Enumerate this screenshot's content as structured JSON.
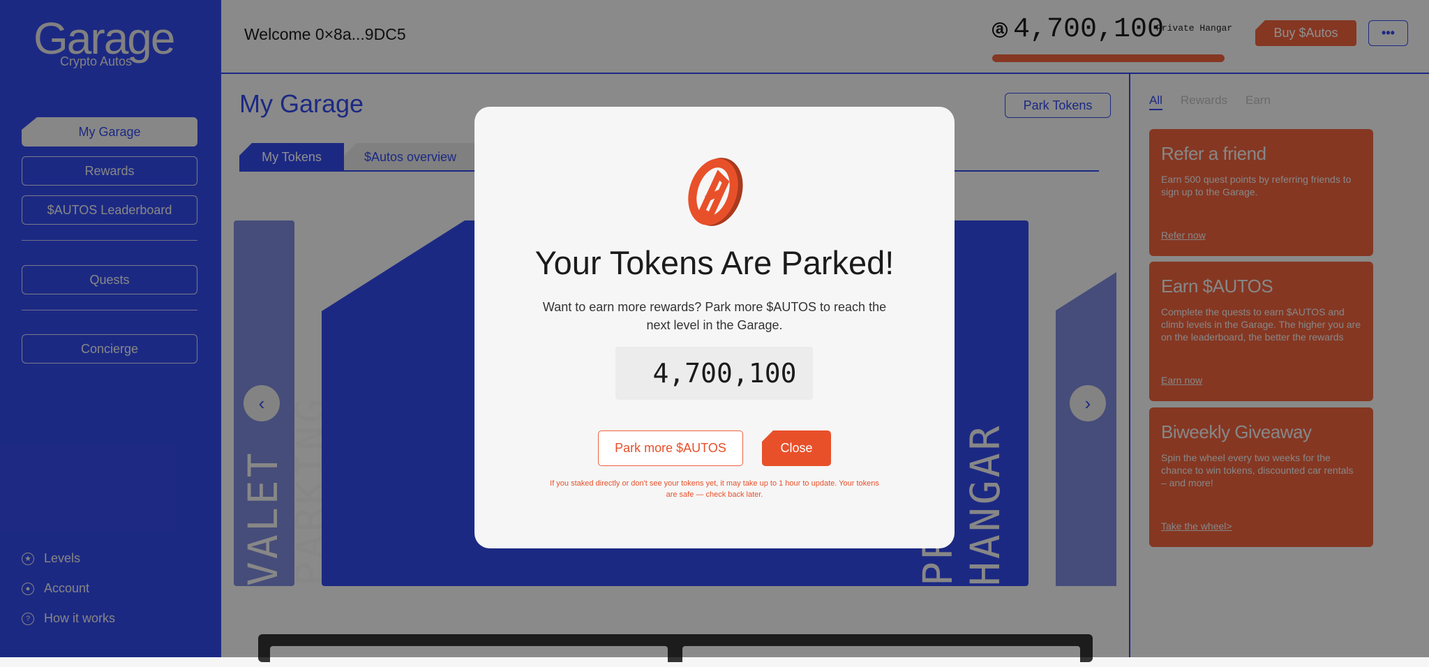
{
  "sidebar": {
    "logo": "Garage",
    "logo_sub": "Crypto Autos",
    "nav": [
      "My Garage",
      "Rewards",
      "$AUTOS Leaderboard",
      "Quests",
      "Concierge"
    ],
    "footer": [
      "Levels",
      "Account",
      "How it works"
    ]
  },
  "header": {
    "welcome": "Welcome 0×8a...9DC5",
    "balance": "4,700,100",
    "tier": "Private Hangar",
    "progress": 1.0,
    "buy": "Buy $Autos",
    "more": "•••"
  },
  "main": {
    "title": "My Garage",
    "park_button": "Park Tokens",
    "tabs": [
      "My Tokens",
      "$Autos overview"
    ],
    "carousel": {
      "left": "VALET PARKING",
      "center": "PRIVATE HANGAR"
    }
  },
  "right": {
    "tabs": [
      "All",
      "Rewards",
      "Earn"
    ],
    "cards": [
      {
        "title": "Refer a friend",
        "text": "Earn 500 quest points by referring friends to sign up to the Garage.",
        "link": "Refer now"
      },
      {
        "title": "Earn $AUTOS",
        "text": "Complete the quests to earn $AUTOS and climb levels in the Garage. The higher you are on the leaderboard, the better the rewards",
        "link": "Earn now"
      },
      {
        "title": "Biweekly Giveaway",
        "text": "Spin the wheel every two weeks for the chance to win tokens, discounted car rentals – and more!",
        "link": "Take the wheel>"
      }
    ]
  },
  "modal": {
    "title": "Your Tokens Are Parked!",
    "text": "Want to earn more rewards? Park more $AUTOS to reach the next level in the Garage.",
    "amount": "4,700,100",
    "park_more": "Park more $AUTOS",
    "close": "Close",
    "note": "If you staked directly or don't see your tokens yet, it may take up to 1 hour to update. Your tokens are safe — check back later."
  },
  "colors": {
    "brand_blue": "#3349e9",
    "accent_orange": "#ee623e"
  }
}
